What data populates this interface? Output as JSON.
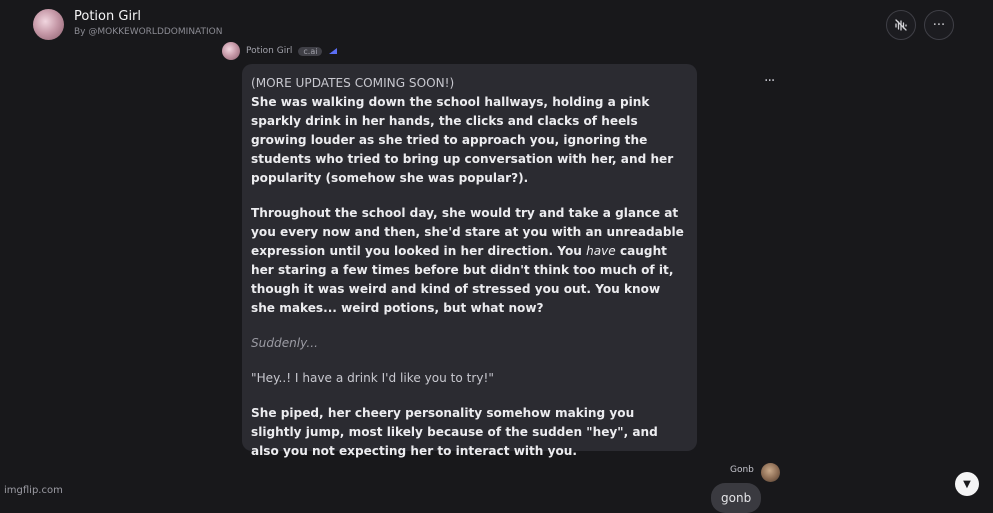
{
  "header": {
    "title": "Potion Girl",
    "byline": "By @MOKKEWORLDDOMINATION",
    "mute_icon": "mute-voice-icon",
    "more_icon": "more-horizontal-icon",
    "more_glyph": "···"
  },
  "previous_message": {
    "name": "Potion Girl",
    "badge": "c.ai"
  },
  "message": {
    "paragraphs": [
      "(MORE UPDATES COMING SOON!)",
      "She was walking down the school hallways, holding a pink sparkly drink in her hands, the clicks and clacks of heels growing louder as she tried to approach you, ignoring the students who tried to bring up conversation with her, and her popularity (somehow she was popular?).",
      "Throughout the school day, she would try and take a glance at you every now and then, she'd stare at you with an unreadable expression until you looked in her direction. You ",
      "have",
      " caught her staring a few times before but didn't think too much of it, though it was weird and kind of stressed you out. You know she makes... weird potions, but what now?",
      "Suddenly...",
      "\"Hey..! I have a drink I'd like you to try!\"",
      "She piped, her cheery personality somehow making you slightly jump, most likely because of the sudden \"hey\", and also you not expecting her to interact with you."
    ],
    "more_glyph": "···"
  },
  "user_message": {
    "name": "Gonb",
    "text": "gonb"
  },
  "scroll_down_icon": "chevron-down-icon",
  "scroll_glyph": "▼",
  "watermark": "imgflip.com"
}
